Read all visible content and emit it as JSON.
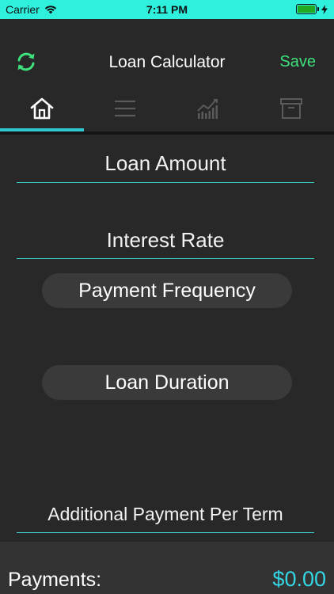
{
  "status_bar": {
    "carrier": "Carrier",
    "time": "7:11 PM"
  },
  "nav": {
    "title": "Loan Calculator",
    "save_label": "Save"
  },
  "tabs": [
    {
      "icon": "home-icon",
      "active": true
    },
    {
      "icon": "list-icon",
      "active": false
    },
    {
      "icon": "chart-icon",
      "active": false
    },
    {
      "icon": "archive-icon",
      "active": false
    }
  ],
  "form": {
    "loan_amount": "Loan Amount",
    "interest_rate": "Interest Rate",
    "payment_frequency": "Payment Frequency",
    "loan_duration": "Loan Duration",
    "additional_payment": "Additional Payment Per Term"
  },
  "footer": {
    "label": "Payments:",
    "value": "$0.00"
  },
  "colors": {
    "status_bar": "#2ef0dc",
    "accent_green": "#3ee07c",
    "accent_cyan": "#2ec9cf",
    "background": "#282828",
    "pill": "#3a3a3a"
  }
}
